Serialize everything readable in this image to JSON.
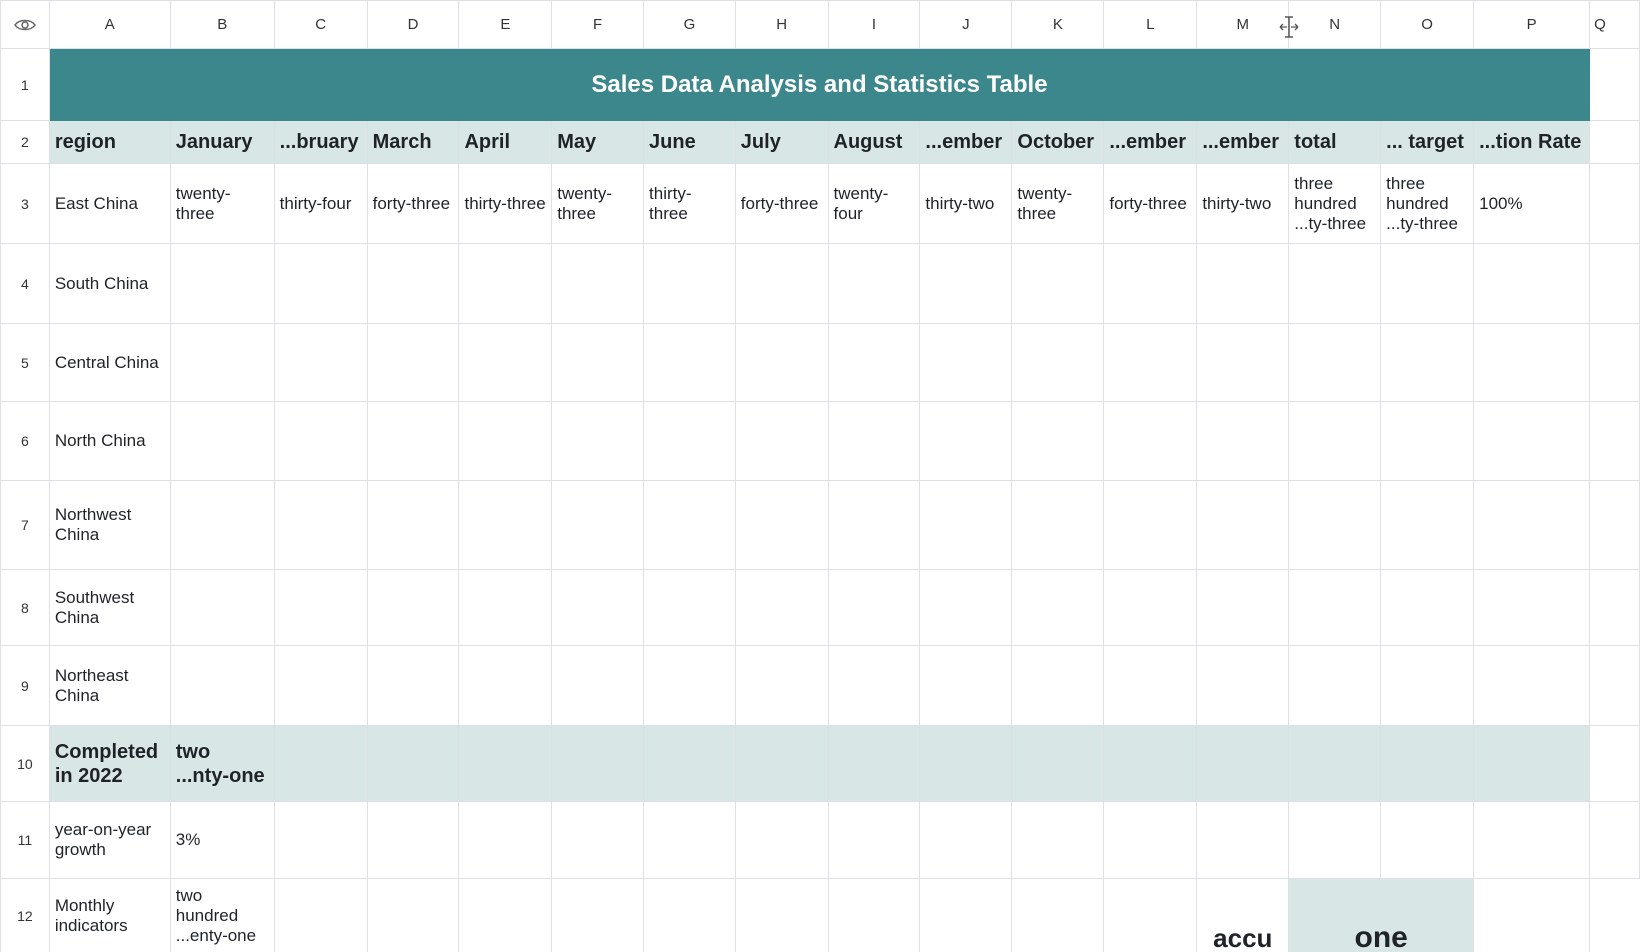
{
  "columns": [
    "A",
    "B",
    "C",
    "D",
    "E",
    "F",
    "G",
    "H",
    "I",
    "J",
    "K",
    "L",
    "M",
    "N",
    "O",
    "P",
    "Q"
  ],
  "row_numbers": [
    "1",
    "2",
    "3",
    "4",
    "5",
    "6",
    "7",
    "8",
    "9",
    "10",
    "11",
    "12"
  ],
  "title": "Sales Data Analysis and Statistics Table",
  "headers": [
    "region",
    "January",
    "...bruary",
    "March",
    "April",
    "May",
    "June",
    "July",
    "August",
    "...ember",
    "October",
    "...ember",
    "...ember",
    "total",
    "... target",
    "...tion Rate"
  ],
  "rows": {
    "r3": [
      "East China",
      "twenty-three",
      "thirty-four",
      "forty-three",
      "thirty-three",
      "twenty-three",
      "thirty-three",
      "forty-three",
      "twenty-four",
      "thirty-two",
      "twenty-three",
      "forty-three",
      "thirty-two",
      "three hundred ...ty-three",
      "three hundred ...ty-three",
      "100%"
    ],
    "r4": "South China",
    "r5": "Central China",
    "r6": "North China",
    "r7": "Northwest China",
    "r8": "Southwest China",
    "r9": "Northeast China",
    "r10": [
      "Completed in 2022",
      "two ...nty-one"
    ],
    "r11": [
      "year-on-year growth",
      "3%"
    ],
    "r12": [
      "Monthly indicators",
      "two hundred ...enty-one",
      "accu",
      "one"
    ]
  },
  "colors": {
    "title_bg": "#3b878c",
    "header_bg": "#d8e7e6",
    "grid": "#dcdfe3"
  },
  "icons": {
    "corner": "eye-icon",
    "cursor": "column-resize-icon"
  }
}
